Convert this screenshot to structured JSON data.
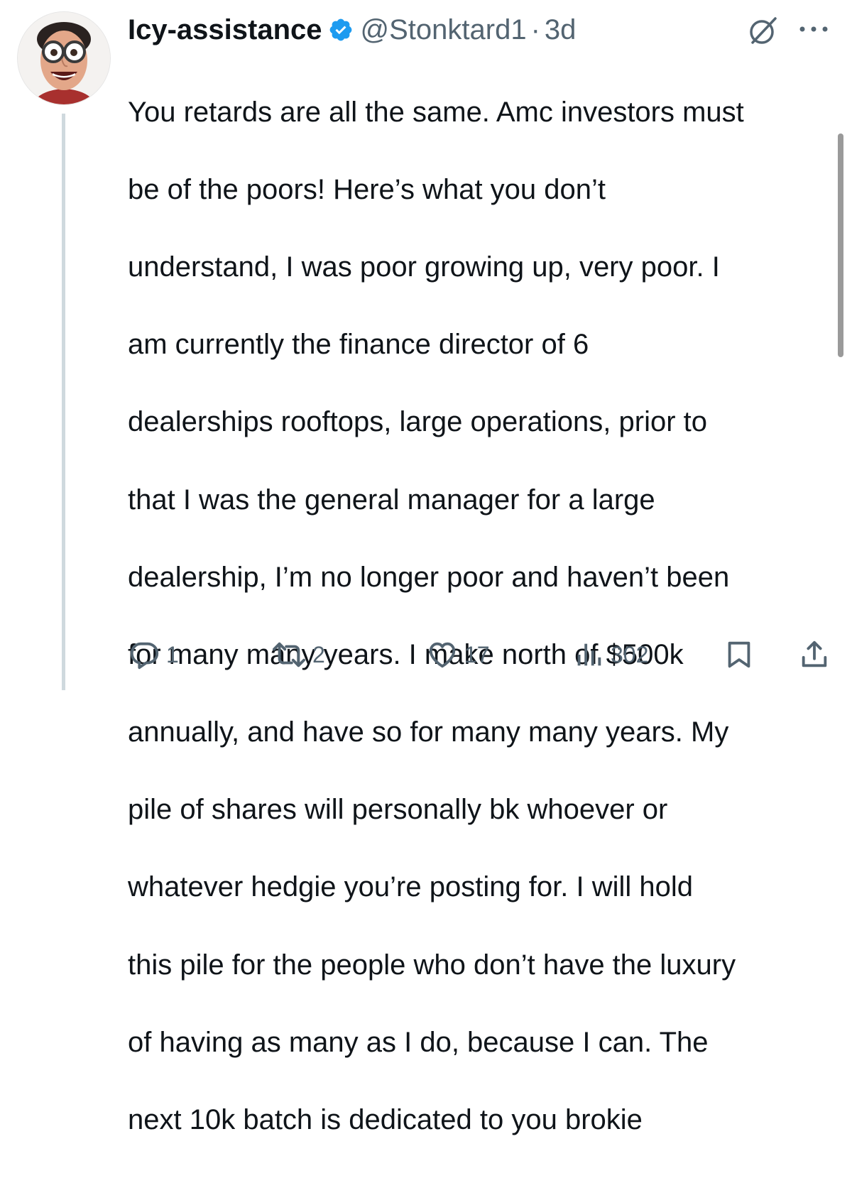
{
  "tweet": {
    "author": {
      "display_name": "Icy-assistance",
      "handle": "@Stonktard1",
      "separator": "·",
      "time": "3d",
      "verified": true,
      "avatar": "avatar-photo-man-with-glasses"
    },
    "lines": [
      "You retards are all the same. Amc investors must",
      "be of the poors! Here’s what you don’t",
      "understand, I was poor growing up, very poor. I",
      "am currently the finance director of 6",
      "dealerships rooftops, large operations, prior to",
      "that I was the general manager for a large",
      "dealership, I’m no longer poor and haven’t been",
      "for many many years. I make north of $500k",
      "annually, and have so for many many years. My",
      "pile of shares will personally bk whoever or",
      "whatever hedgie you’re posting for. I will hold",
      "this pile for the people who don’t have the luxury",
      "of having as many as I do, because I can. The",
      "next 10k batch is dedicated to you brokie"
    ],
    "metrics": {
      "replies": "1",
      "reposts": "2",
      "likes": "17",
      "views": "302"
    }
  },
  "icons": {
    "verified": "verified-badge-icon",
    "grok": "grok-icon",
    "more": "more-icon",
    "reply": "reply-icon",
    "repost": "repost-icon",
    "like": "heart-icon",
    "views": "views-chart-icon",
    "bookmark": "bookmark-icon",
    "share": "share-icon"
  },
  "colors": {
    "text": "#0f1419",
    "secondary": "#536471",
    "verified": "#1d9bf0",
    "thread_line": "#cfd9de"
  }
}
